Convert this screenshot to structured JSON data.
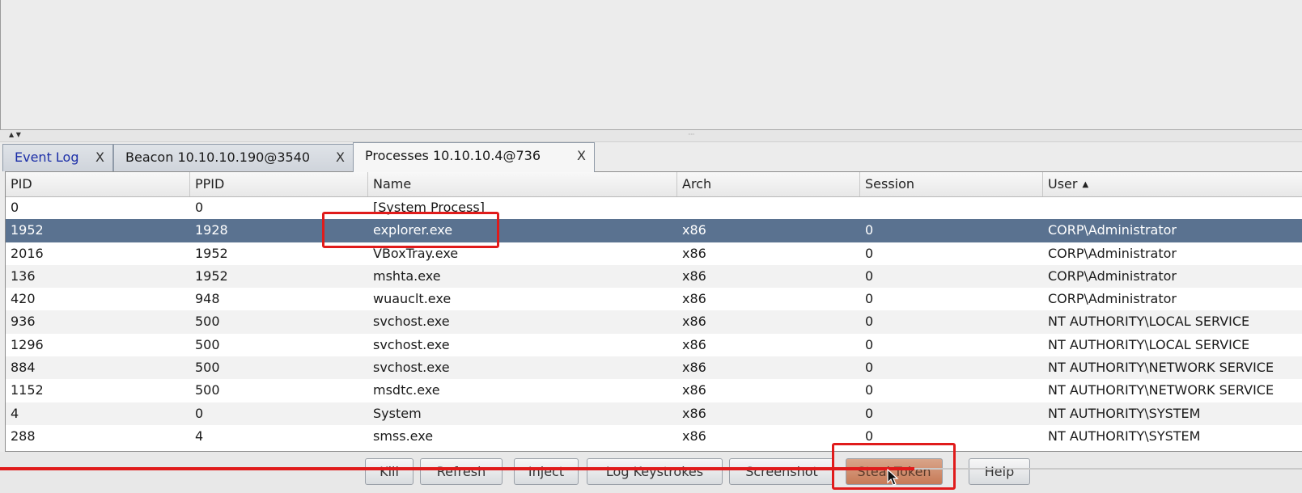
{
  "tabs": [
    {
      "label": "Event Log",
      "close": "X"
    },
    {
      "label": "Beacon 10.10.10.190@3540",
      "close": "X"
    },
    {
      "label": "Processes 10.10.10.4@736",
      "close": "X"
    }
  ],
  "table": {
    "columns": [
      "PID",
      "PPID",
      "Name",
      "Arch",
      "Session",
      "User"
    ],
    "sort_indicator": "▲",
    "rows": [
      {
        "pid": "0",
        "ppid": "0",
        "name": "[System Process]",
        "arch": "",
        "session": "",
        "user": ""
      },
      {
        "pid": "1952",
        "ppid": "1928",
        "name": "explorer.exe",
        "arch": "x86",
        "session": "0",
        "user": "CORP\\Administrator"
      },
      {
        "pid": "2016",
        "ppid": "1952",
        "name": "VBoxTray.exe",
        "arch": "x86",
        "session": "0",
        "user": "CORP\\Administrator"
      },
      {
        "pid": "136",
        "ppid": "1952",
        "name": "mshta.exe",
        "arch": "x86",
        "session": "0",
        "user": "CORP\\Administrator"
      },
      {
        "pid": "420",
        "ppid": "948",
        "name": "wuauclt.exe",
        "arch": "x86",
        "session": "0",
        "user": "CORP\\Administrator"
      },
      {
        "pid": "936",
        "ppid": "500",
        "name": "svchost.exe",
        "arch": "x86",
        "session": "0",
        "user": "NT AUTHORITY\\LOCAL SERVICE"
      },
      {
        "pid": "1296",
        "ppid": "500",
        "name": "svchost.exe",
        "arch": "x86",
        "session": "0",
        "user": "NT AUTHORITY\\LOCAL SERVICE"
      },
      {
        "pid": "884",
        "ppid": "500",
        "name": "svchost.exe",
        "arch": "x86",
        "session": "0",
        "user": "NT AUTHORITY\\NETWORK SERVICE"
      },
      {
        "pid": "1152",
        "ppid": "500",
        "name": "msdtc.exe",
        "arch": "x86",
        "session": "0",
        "user": "NT AUTHORITY\\NETWORK SERVICE"
      },
      {
        "pid": "4",
        "ppid": "0",
        "name": "System",
        "arch": "x86",
        "session": "0",
        "user": "NT AUTHORITY\\SYSTEM"
      },
      {
        "pid": "288",
        "ppid": "4",
        "name": "smss.exe",
        "arch": "x86",
        "session": "0",
        "user": "NT AUTHORITY\\SYSTEM"
      }
    ]
  },
  "buttons": [
    "Kill",
    "Refresh",
    "Inject",
    "Log Keystrokes",
    "Screenshot",
    "Steal Token",
    "Help"
  ],
  "splitter": {
    "arrows": "▲ ▼",
    "grip": "·····"
  },
  "icons": {
    "sort": "triangle-up-icon",
    "cursor": "mouse-pointer-icon"
  },
  "colors": {
    "selected_row": "#5a7290",
    "annotation": "#e01b1b",
    "pressed_button": "#c77a57"
  }
}
